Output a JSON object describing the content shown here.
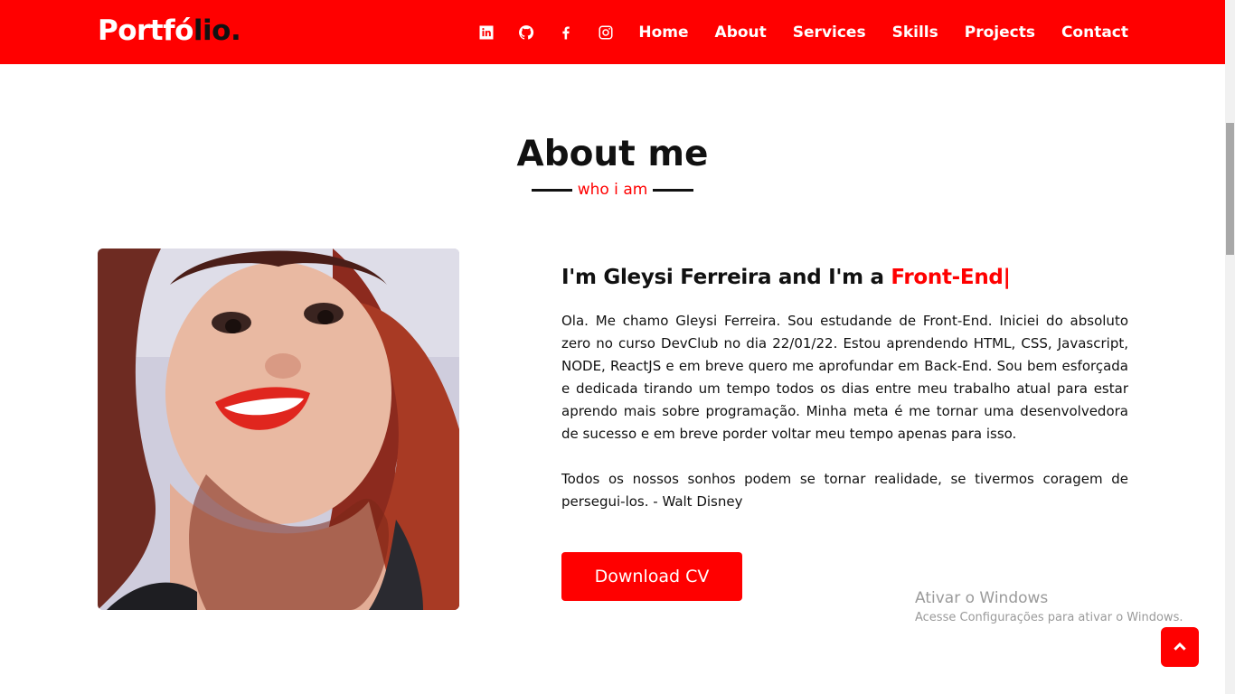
{
  "brand": {
    "logo_part1": "Portfó",
    "logo_part2": "lio."
  },
  "nav": {
    "social_icons": [
      "linkedin-icon",
      "github-icon",
      "facebook-icon",
      "instagram-icon"
    ],
    "links": [
      "Home",
      "About",
      "Services",
      "Skills",
      "Projects",
      "Contact"
    ]
  },
  "about": {
    "title": "About me",
    "subtitle": "who i am",
    "heading_prefix": "I'm Gleysi Ferreira and I'm a ",
    "heading_role": "Front-End|",
    "paragraph": "Ola. Me chamo Gleysi Ferreira. Sou estudande de Front-End. Iniciei do absoluto zero no curso DevClub no dia 22/01/22. Estou aprendendo HTML, CSS, Javascript, NODE, ReactJS e em breve quero me aprofundar em Back-End. Sou bem esforçada e dedicada tirando um tempo todos os dias entre meu trabalho atual para estar aprendo mais sobre programação. Minha meta é me tornar uma desenvolvedora de sucesso e em breve porder voltar meu tempo apenas para isso.",
    "quote": "Todos os nossos sonhos podem se tornar realidade, se tivermos coragem de persegui-los. - Walt Disney",
    "button": "Download CV"
  },
  "watermark": {
    "line1": "Ativar o Windows",
    "line2": "Acesse Configurações para ativar o Windows."
  },
  "colors": {
    "accent": "#ff0000",
    "text": "#111111",
    "background": "#ffffff"
  }
}
